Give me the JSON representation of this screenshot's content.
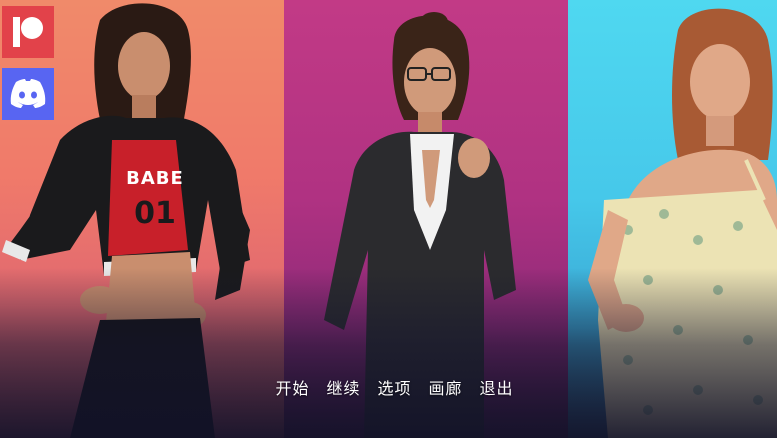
{
  "colors": {
    "left_bg": "#f08a6a",
    "mid_bg": "#b03282",
    "right_bg": "#46c8ea",
    "patreon": "#e2424a",
    "discord": "#5865f2",
    "menu_text": "#ffffff"
  },
  "social": {
    "patreon_icon": "patreon-icon",
    "discord_icon": "discord-icon"
  },
  "characters": {
    "left_shirt_text": "BABE",
    "left_shirt_number": "01"
  },
  "menu": {
    "items": [
      "开始",
      "继续",
      "选项",
      "画廊",
      "退出"
    ]
  }
}
